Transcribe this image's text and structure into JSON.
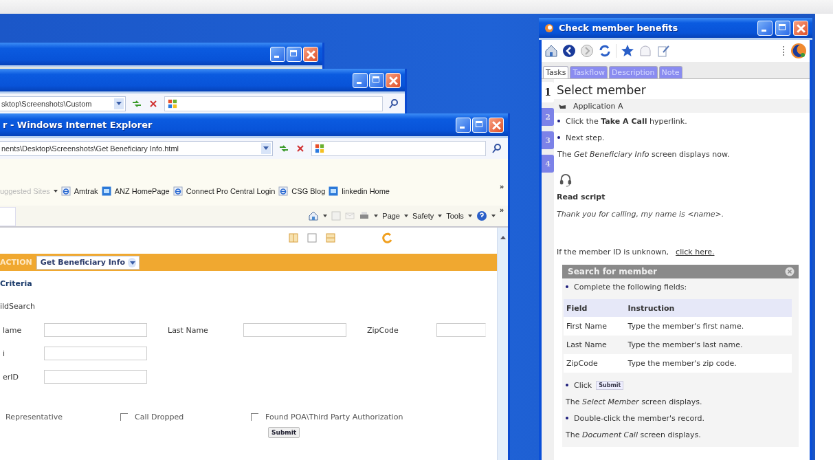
{
  "middle_window": {
    "address": "sktop\\Screenshots\\Custom"
  },
  "browser": {
    "title": "r - Windows Internet Explorer",
    "address": "nents\\Desktop\\Screenshots\\Get Beneficiary Info.html",
    "favorites_bar": {
      "items": [
        {
          "label": "uggested Sites",
          "kind": "menu"
        },
        {
          "label": "Amtrak",
          "kind": "ie"
        },
        {
          "label": "ANZ HomePage",
          "kind": "tile"
        },
        {
          "label": "Connect Pro Central Login",
          "kind": "ie"
        },
        {
          "label": "CSG Blog",
          "kind": "ie"
        },
        {
          "label": "linkedin Home",
          "kind": "tile"
        }
      ],
      "overflow": "»"
    },
    "command_bar": {
      "menus": [
        "Page",
        "Safety",
        "Tools"
      ],
      "overflow": "»"
    }
  },
  "page": {
    "action_label": "ACTION",
    "action_select": "Get Beneficiary Info",
    "section": "Criteria",
    "subsection": "ildSearch",
    "field_rows": [
      [
        {
          "label": "lame"
        },
        {
          "label": "Last Name"
        },
        {
          "label": "ZipCode"
        }
      ],
      [
        {
          "label": "i"
        }
      ],
      [
        {
          "label": "erID"
        }
      ]
    ],
    "options": [
      {
        "label": "Representative",
        "kind": "text"
      },
      {
        "label": "Call Dropped",
        "kind": "checkbox",
        "checked": false
      },
      {
        "label": "Found POA\\Third Party Authorization",
        "kind": "checkbox",
        "checked": false
      }
    ],
    "submit": "Submit"
  },
  "guide": {
    "title": "Check member benefits",
    "tabs": [
      {
        "label": "Tasks",
        "selected": true
      },
      {
        "label": "Taskflow",
        "selected": false
      },
      {
        "label": "Description",
        "selected": false
      },
      {
        "label": "Note",
        "selected": false
      }
    ],
    "steps": [
      {
        "label": "1",
        "selected": true
      },
      {
        "label": "2",
        "selected": false
      },
      {
        "label": "3",
        "selected": false
      },
      {
        "label": "4",
        "selected": false
      }
    ],
    "heading": "Select member",
    "application": "Application A",
    "items": [
      {
        "kind": "bullet",
        "text": "Click the **Take A Call** hyperlink."
      },
      {
        "kind": "bullet",
        "text": "Next step."
      },
      {
        "kind": "note",
        "text": "The *Get Beneficiary Info* screen displays now."
      }
    ],
    "script": {
      "title": "Read script",
      "text": "Thank you for calling, my name is <name>."
    },
    "unknown_id": {
      "text": "If the member ID is unknown,",
      "link": "click here."
    },
    "search_card": {
      "title": "Search for member",
      "intro": "Complete the following fields:",
      "columns": [
        "Field",
        "Instruction"
      ],
      "rows": [
        [
          "First Name",
          "Type the member's first name."
        ],
        [
          "Last Name",
          "Type the member's last name."
        ],
        [
          "ZipCode",
          "Type the member's zip code."
        ]
      ],
      "steps": [
        {
          "kind": "click",
          "text": "Click",
          "button": "Submit"
        },
        {
          "kind": "note",
          "text": "The *Select Member* screen displays."
        },
        {
          "kind": "bullet",
          "text": "Double-click the member's record."
        },
        {
          "kind": "note",
          "text": "The *Document Call* screen displays."
        }
      ]
    }
  }
}
